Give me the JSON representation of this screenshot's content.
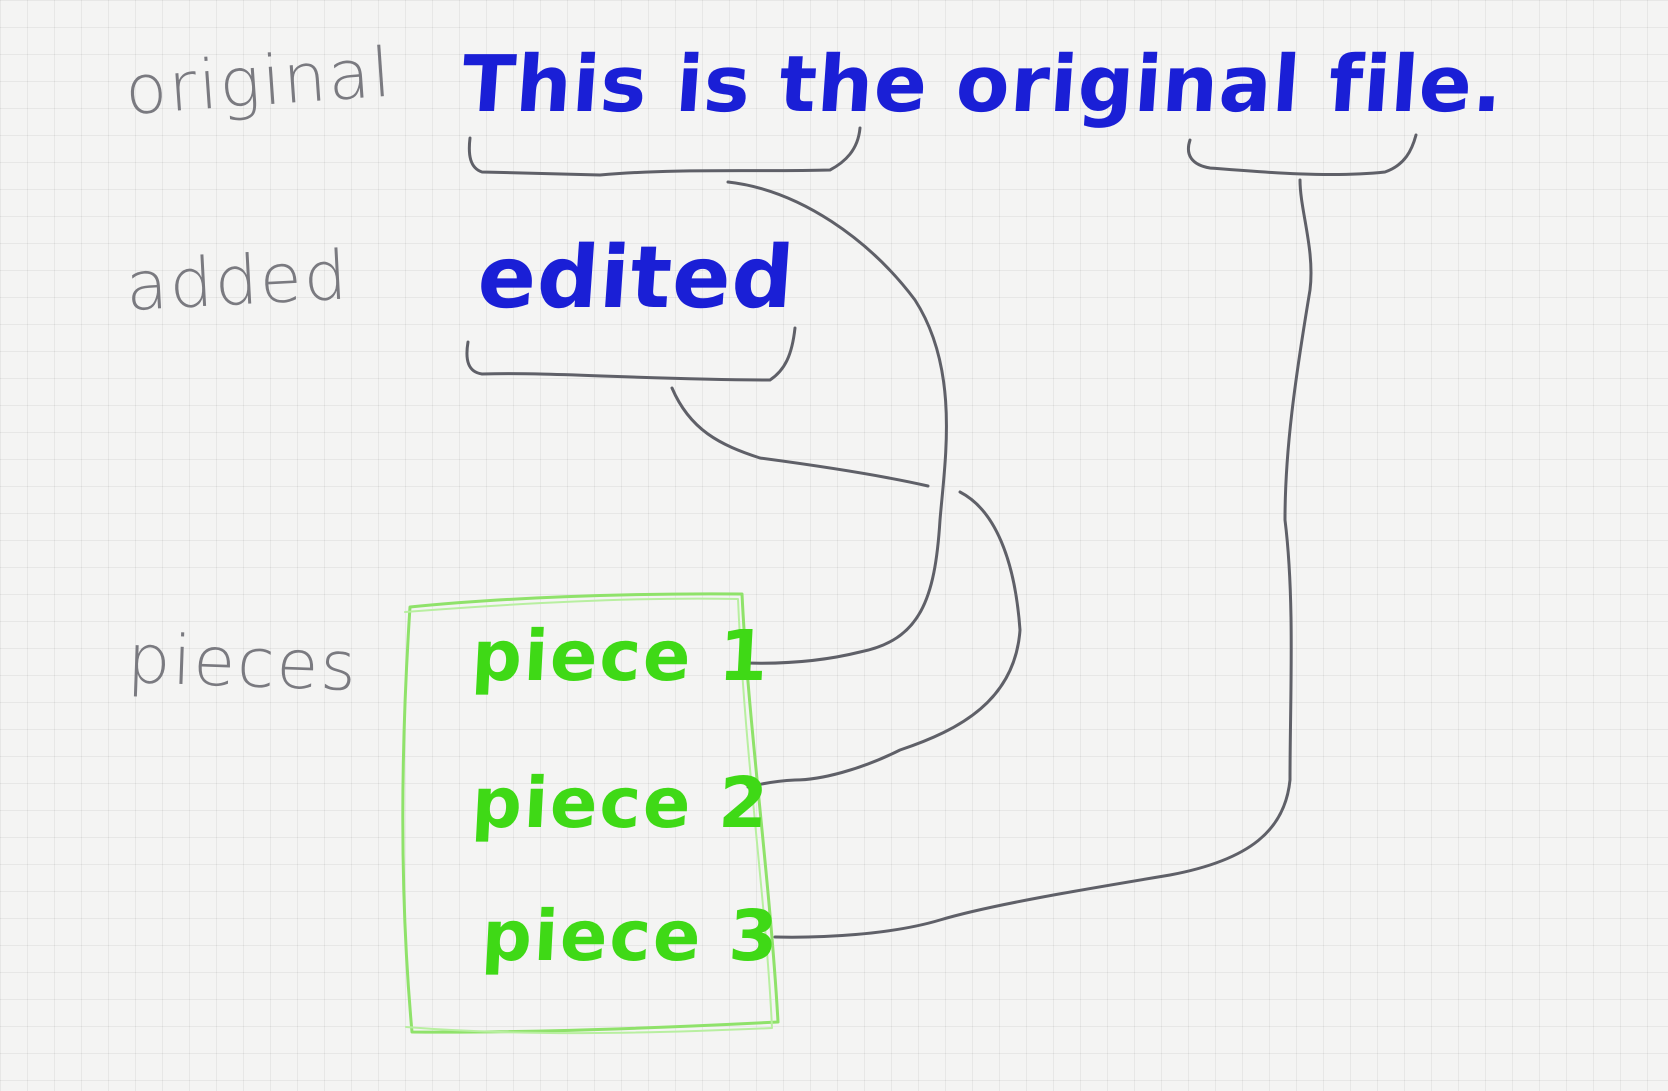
{
  "labels": {
    "original": "original",
    "added": "added",
    "pieces": "pieces"
  },
  "original_text": "This is the original file.",
  "added_text": "edited",
  "pieces": [
    {
      "label": "piece 1"
    },
    {
      "label": "piece 2"
    },
    {
      "label": "piece 3"
    }
  ],
  "colors": {
    "original_ink": "#1a1fd6",
    "added_ink": "#1a1fd6",
    "piece_ink": "#3fd916",
    "box_border": "#8fe26a",
    "label_ink": "#7a7a80",
    "connector_ink": "#5f6068"
  }
}
